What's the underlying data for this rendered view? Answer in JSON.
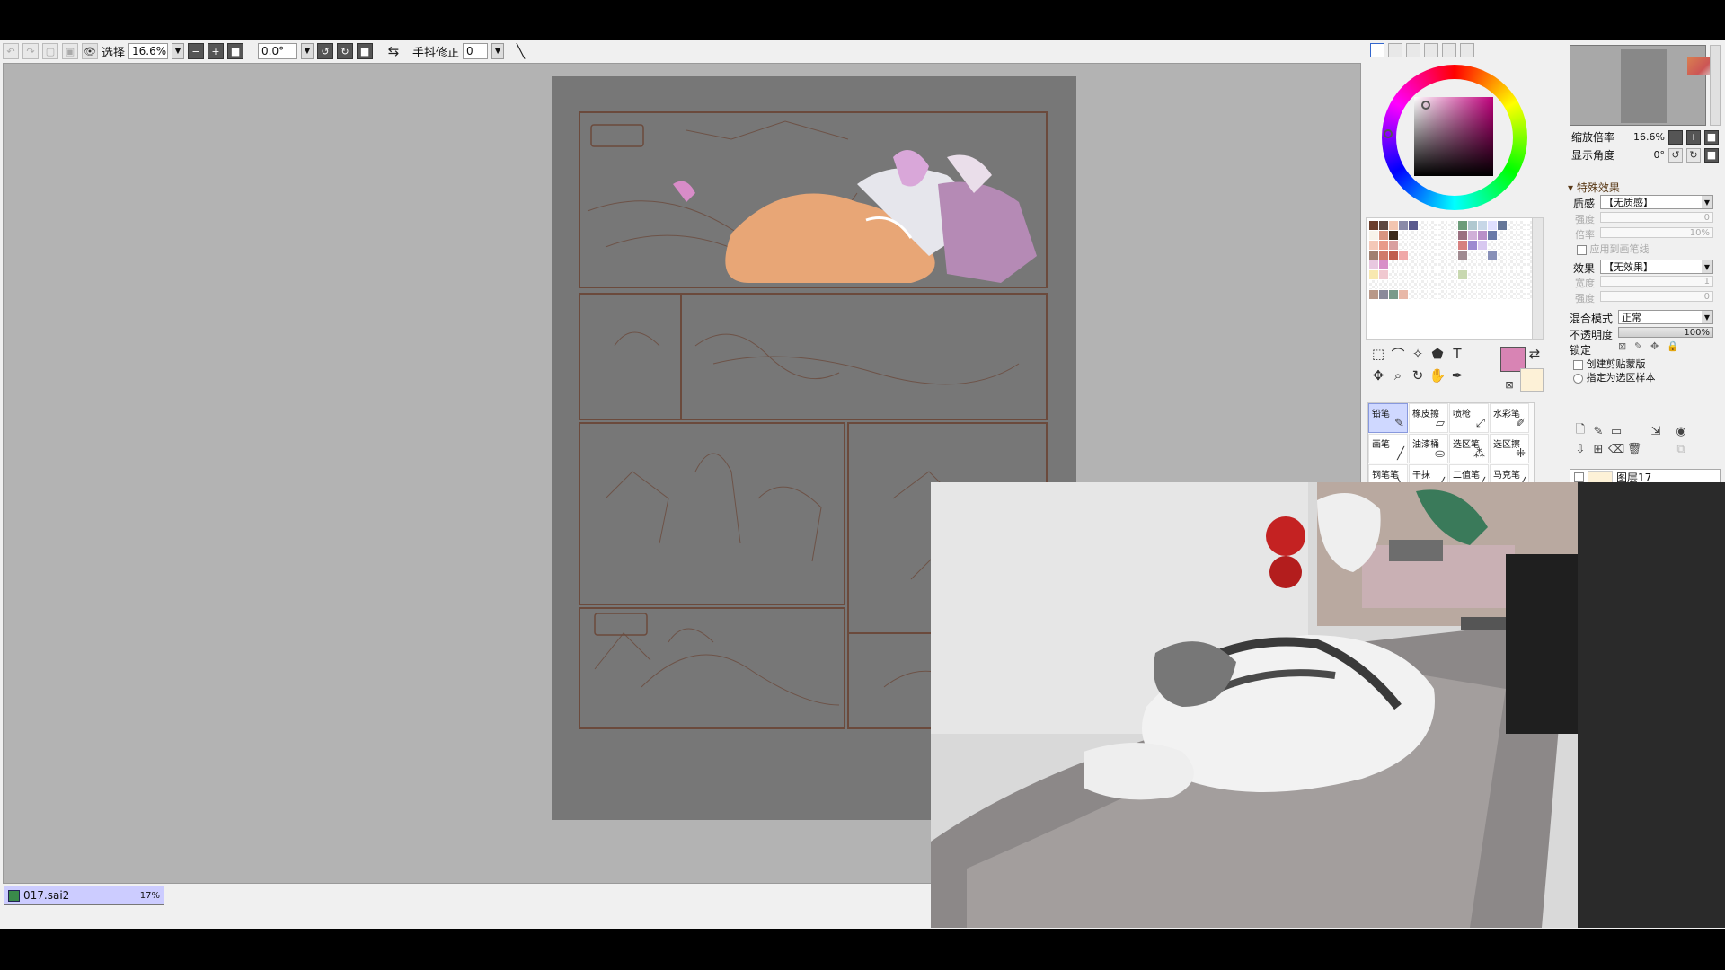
{
  "toolbar": {
    "selection_label": "选择",
    "zoom_value": "16.6%",
    "rotation_value": "0.0°",
    "stabilizer_label": "手抖修正",
    "stabilizer_value": "0"
  },
  "document": {
    "tab_filename": "017.sai2",
    "tab_zoom": "17%"
  },
  "navigator": {
    "zoom_label": "缩放倍率",
    "zoom_value": "16.6%",
    "angle_label": "显示角度",
    "angle_value": "0°"
  },
  "effects": {
    "section_title": "特殊效果",
    "texture_label": "质感",
    "texture_value": "【无质感】",
    "texture_strength_label": "强度",
    "texture_strength_value": "0",
    "texture_scale_label": "倍率",
    "texture_scale_value": "10%",
    "apply_to_brush_label": "应用到画笔线",
    "effect_label": "效果",
    "effect_value": "【无效果】",
    "effect_width_label": "宽度",
    "effect_width_value": "1",
    "effect_strength_label": "强度",
    "effect_strength_value": "0"
  },
  "layer_props": {
    "blend_mode_label": "混合模式",
    "blend_mode_value": "正常",
    "opacity_label": "不透明度",
    "opacity_value": "100%",
    "opacity_level": 1.0,
    "lock_label": "锁定",
    "clip_mask_label": "创建剪贴蒙版",
    "selection_source_label": "指定为选区样本"
  },
  "layers": [
    {
      "name": "图层17"
    }
  ],
  "brushes": [
    {
      "name": "铅笔",
      "glyph": "✎",
      "selected": true
    },
    {
      "name": "橡皮擦",
      "glyph": "▱",
      "selected": false
    },
    {
      "name": "喷枪",
      "glyph": "⤢",
      "selected": false
    },
    {
      "name": "水彩笔",
      "glyph": "✐",
      "selected": false
    },
    {
      "name": "画笔",
      "glyph": "╱",
      "selected": false
    },
    {
      "name": "油漆桶",
      "glyph": "⛀",
      "selected": false
    },
    {
      "name": "选区笔",
      "glyph": "⁂",
      "selected": false
    },
    {
      "name": "选区擦",
      "glyph": "⁜",
      "selected": false
    },
    {
      "name": "钢笔笔",
      "glyph": "╲",
      "selected": false
    },
    {
      "name": "干抹",
      "glyph": "╱",
      "selected": false
    },
    {
      "name": "二值笔",
      "glyph": "╱",
      "selected": false
    },
    {
      "name": "马克笔",
      "glyph": "╱",
      "selected": false
    }
  ],
  "colors": {
    "foreground": "#d884b4",
    "background": "#fdf1d7",
    "wheel_selected": "#c0007c",
    "line_art": "#6b4a3c",
    "canvas_bg": "#b3b3b3",
    "page_bg": "#777777"
  },
  "swatches": [
    "#6b3e2c",
    "#5d4740",
    "#f3c5b0",
    "#8a8aa8",
    "#5a5a8e",
    "",
    "",
    "",
    "",
    "#6c9c7a",
    "#b0c8d0",
    "#c7d7e7",
    "#e0e0ff",
    "#667799",
    "",
    "",
    "",
    "#f8f3ea",
    "#d89480",
    "#3b2a1c",
    "",
    "",
    "",
    "",
    "",
    "",
    "#9a6f80",
    "#d0b0d8",
    "#b890c8",
    "#6a7aa8",
    "",
    "",
    "",
    "",
    "#f4c8b8",
    "#e89a8a",
    "#d9a0a0",
    "",
    "",
    "",
    "",
    "",
    "",
    "#d68080",
    "#9c8ad0",
    "#d8c8f0",
    "",
    "",
    "",
    "",
    "",
    "#a08070",
    "#d07a6a",
    "#c05c4c",
    "#f0a8a8",
    "",
    "",
    "",
    "",
    "",
    "#a08a90",
    "",
    "",
    "#8890b8",
    "",
    "",
    "",
    "",
    "#e8c8e0",
    "#d890c8",
    "",
    "",
    "",
    "",
    "",
    "",
    "",
    "",
    "",
    "",
    "",
    "",
    "",
    "",
    "",
    "#f8e8b0",
    "#f0c8d0",
    "",
    "",
    "",
    "",
    "",
    "",
    "",
    "#c8d8b0",
    "",
    "",
    "",
    "",
    "",
    "",
    "",
    "",
    "",
    "",
    "",
    "",
    "",
    "",
    "",
    "",
    "",
    "",
    "",
    "",
    "",
    "",
    "",
    "",
    "#b89888",
    "#8a8a9a",
    "#7a9a8a",
    "#e8b8a8",
    "",
    "",
    "",
    "",
    "",
    "",
    "",
    "",
    "",
    "",
    "",
    "",
    ""
  ],
  "tool_icons": [
    {
      "name": "rect-select-icon",
      "glyph": "⬚"
    },
    {
      "name": "lasso-icon",
      "glyph": "⌒"
    },
    {
      "name": "magic-wand-icon",
      "glyph": "✧"
    },
    {
      "name": "shape-icon",
      "glyph": "⬟"
    },
    {
      "name": "text-icon",
      "glyph": "T"
    },
    {
      "name": "move-icon",
      "glyph": "✥"
    },
    {
      "name": "zoom-icon",
      "glyph": "⌕"
    },
    {
      "name": "rotate-icon",
      "glyph": "↻"
    },
    {
      "name": "hand-icon",
      "glyph": "✋"
    },
    {
      "name": "eyedropper-icon",
      "glyph": "✒"
    }
  ]
}
